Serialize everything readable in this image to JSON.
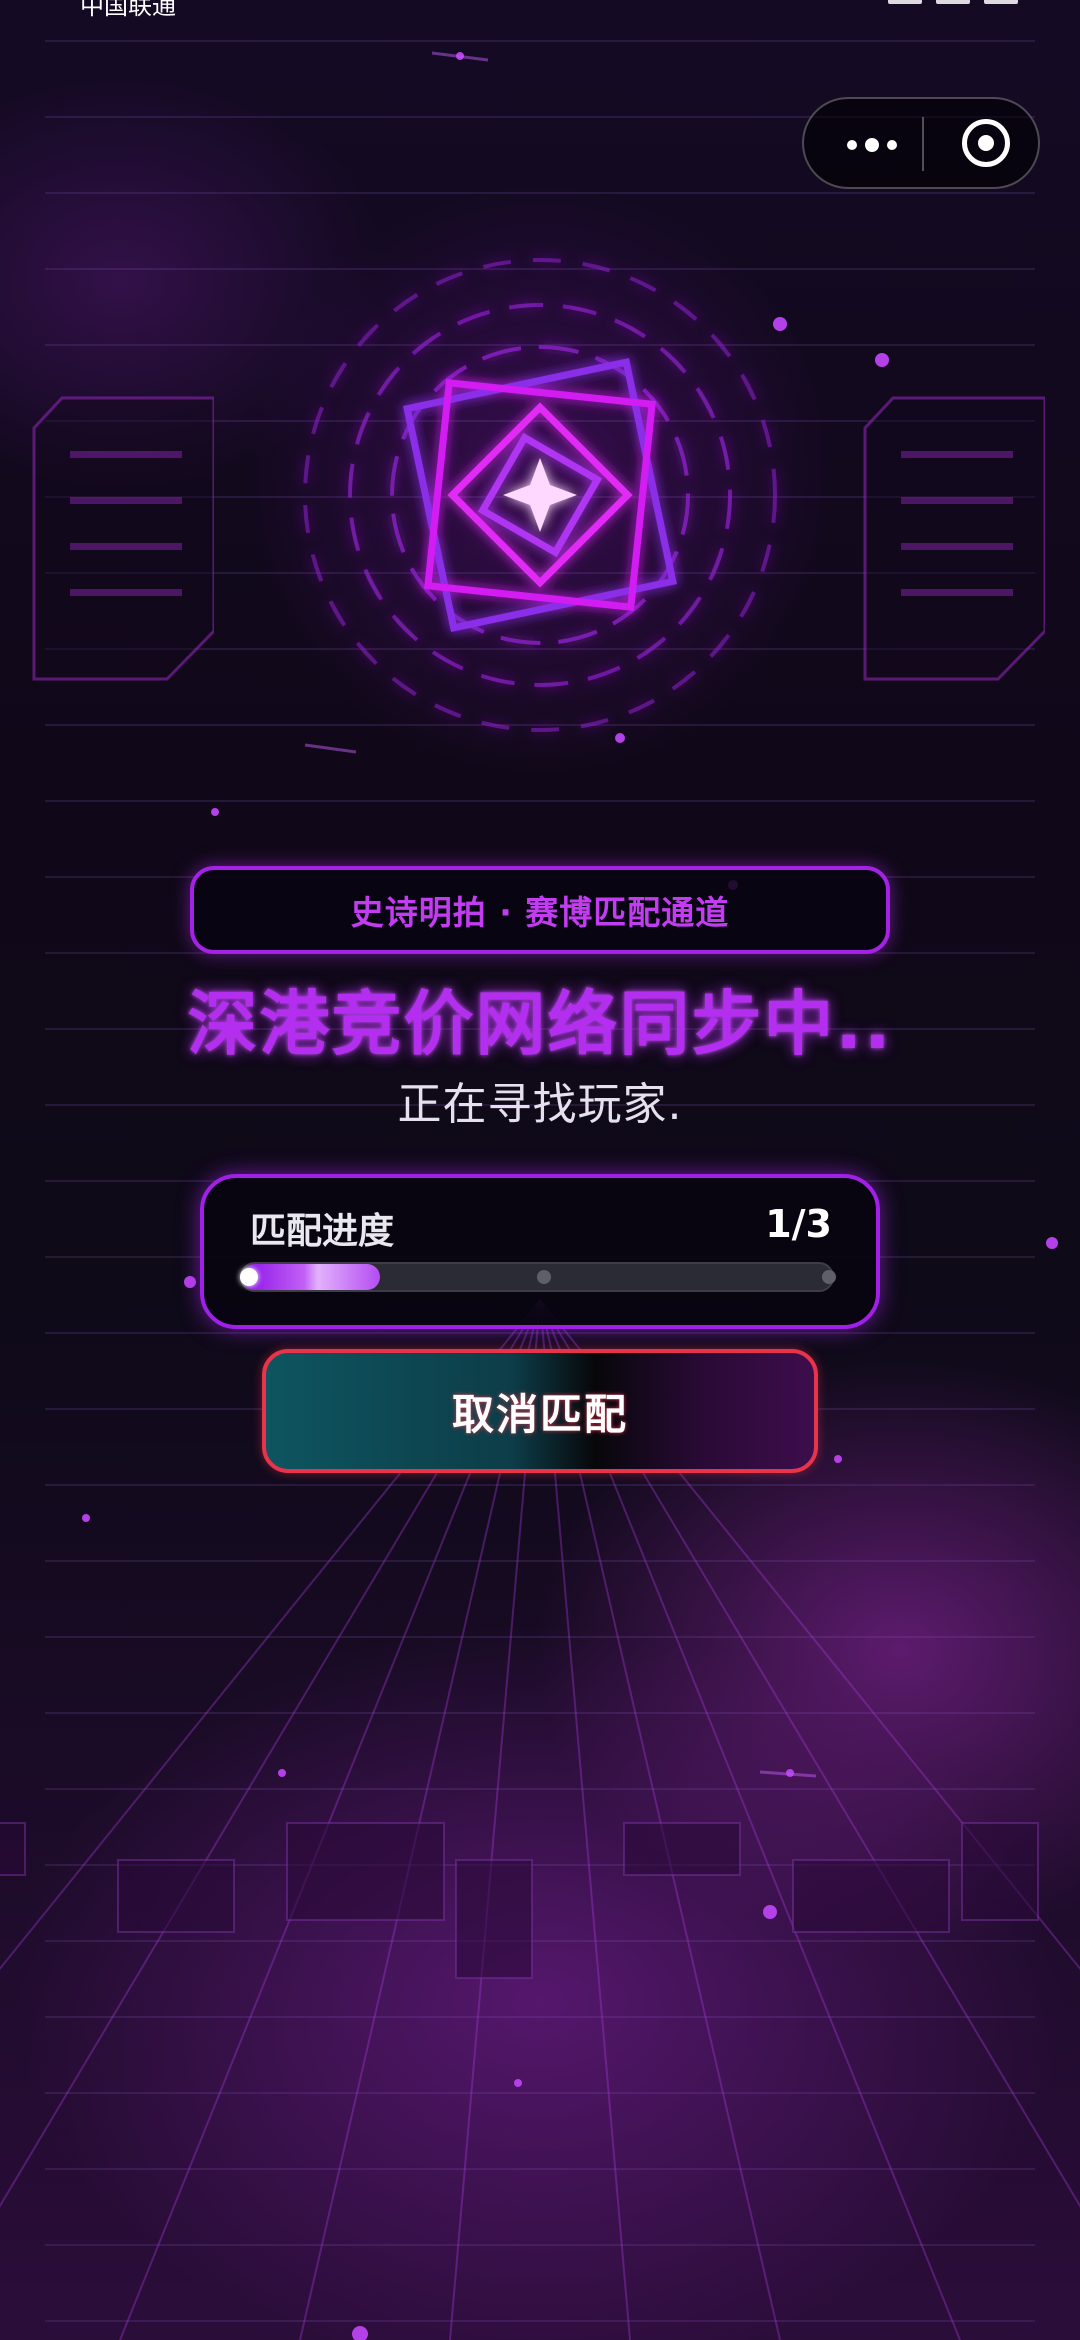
{
  "status_bar": {
    "carrier": "中国联通"
  },
  "capsule": {
    "more_icon": "more-dots-icon",
    "close_icon": "target-close-icon"
  },
  "matching": {
    "channel_title": "史诗明拍 · 赛博匹配通道",
    "headline": "深港竞价网络同步中..",
    "status_text": "正在寻找玩家."
  },
  "progress": {
    "label": "匹配进度",
    "count_text": "1/3",
    "current": 1,
    "total": 3
  },
  "cancel_button": {
    "label": "取消匹配"
  },
  "colors": {
    "accent": "#a422e6",
    "headline": "#b42ef0",
    "cancel_border": "#e8344a",
    "background": "#0c0716"
  },
  "icons": [
    "cyber-sigil-icon",
    "sparkle-star-icon"
  ]
}
